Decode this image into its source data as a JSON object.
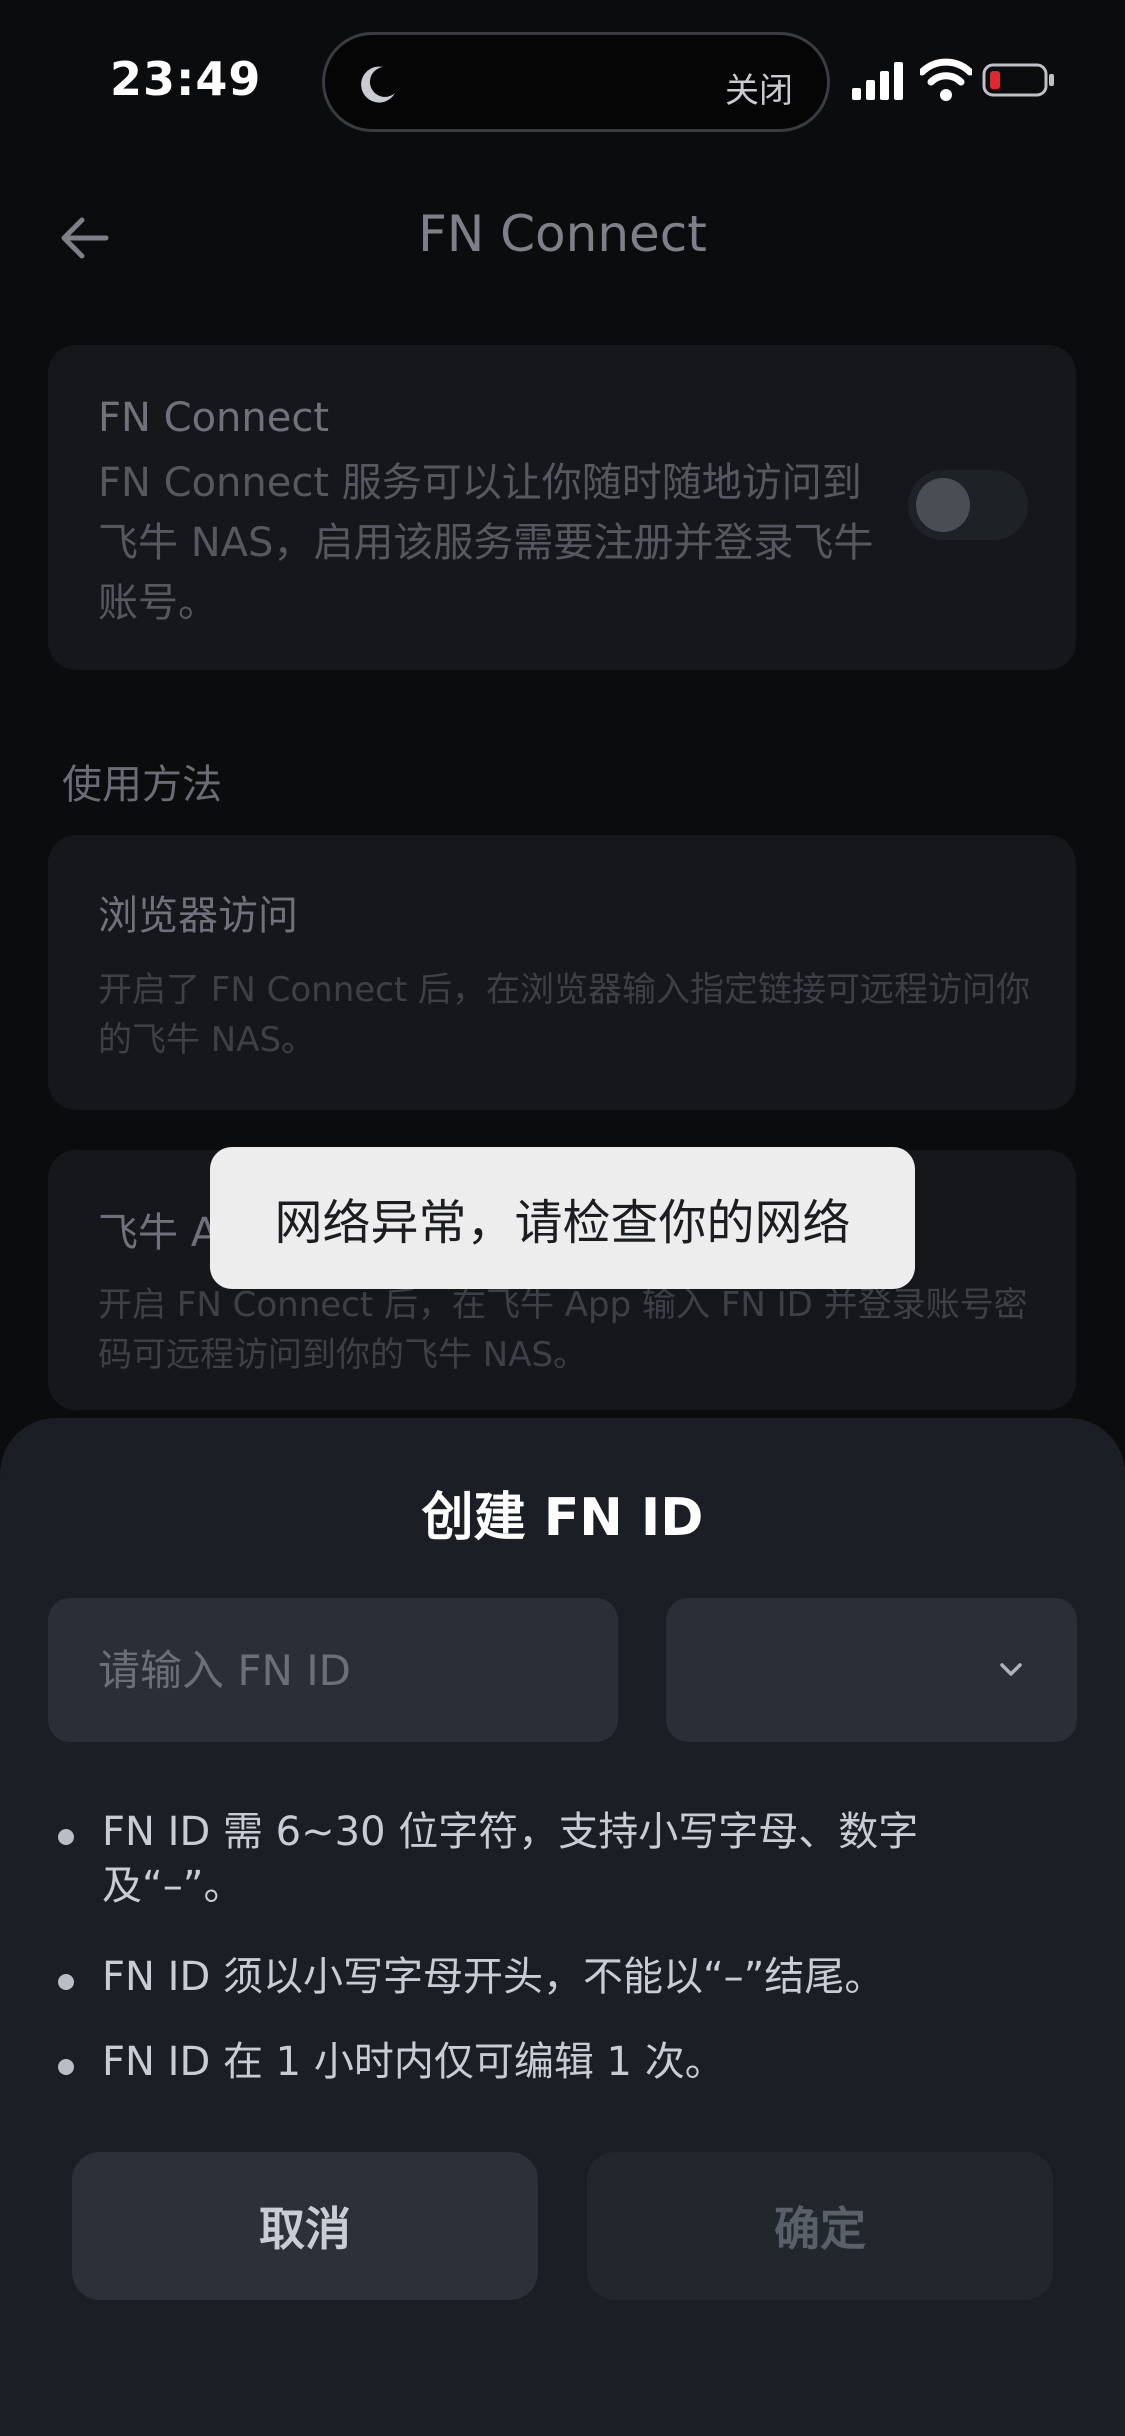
{
  "status_bar": {
    "time": "23:49",
    "island_label": "关闭"
  },
  "header": {
    "title": "FN Connect"
  },
  "connect_card": {
    "title": "FN Connect",
    "description": "FN Connect 服务可以让你随时随地访问到飞牛 NAS，启用该服务需要注册并登录飞牛账号。",
    "toggle_on": false
  },
  "usage": {
    "section_label": "使用方法",
    "methods": [
      {
        "title": "浏览器访问",
        "description": "开启了 FN Connect 后，在浏览器输入指定链接可远程访问你的飞牛 NAS。"
      },
      {
        "title": "飞牛 App",
        "description": "开启 FN Connect 后，在飞牛 App 输入 FN ID 并登录账号密码可远程访问到你的飞牛 NAS。"
      }
    ]
  },
  "toast": {
    "message": "网络异常，请检查你的网络"
  },
  "sheet": {
    "title": "创建 FN ID",
    "fnid_input": {
      "value": "",
      "placeholder": "请输入 FN ID"
    },
    "domain_select": {
      "selected": ""
    },
    "rules": [
      "FN ID 需 6~30 位字符，支持小写字母、数字及“–”。",
      "FN ID 须以小写字母开头，不能以“–”结尾。",
      "FN ID 在 1 小时内仅可编辑 1 次。"
    ],
    "cancel_label": "取消",
    "confirm_label": "确定"
  },
  "colors": {
    "background": "#0b0c0e",
    "sheet": "#1b1e24",
    "input": "#2a2e36",
    "toast": "#ededee",
    "battery_low": "#e5262b"
  }
}
